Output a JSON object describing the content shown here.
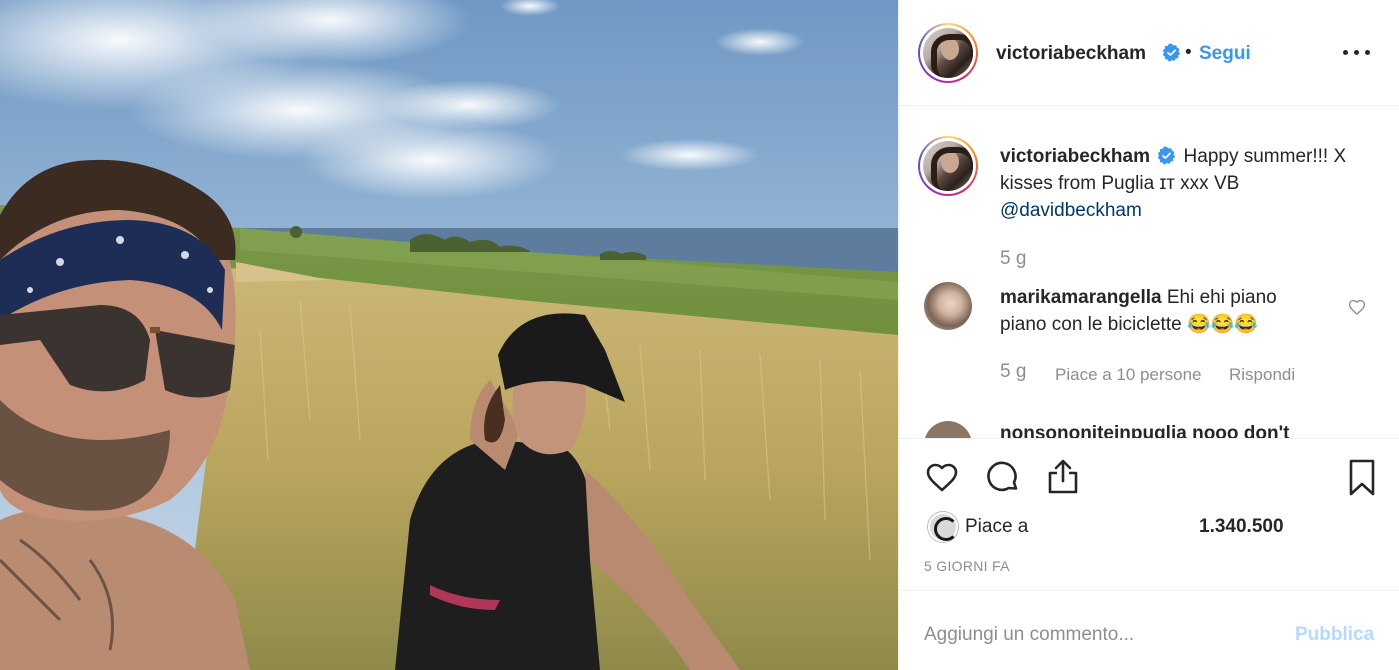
{
  "post": {
    "username": "victoriabeckham",
    "dot": "•",
    "follow_label": "Segui",
    "icons": {
      "verified": "verified-badge-icon",
      "more": "more-options-icon",
      "like": "heart-icon",
      "comment": "comment-bubble-icon",
      "share": "share-icon",
      "save": "bookmark-icon"
    },
    "accent_color": "#3897f0"
  },
  "caption": {
    "username": "victoriabeckham",
    "text_line1": "Happy summer!!! X",
    "text_line2": "kisses from Puglia ɪᴛ xxx VB",
    "mention": "@davidbeckham",
    "time": "5 g"
  },
  "comments": [
    {
      "username": "marikamarangella",
      "text_line1": "Ehi ehi piano",
      "text_line2": "piano con le biciclette 😂😂😂",
      "time": "5 g",
      "likes": "Piace a 10 persone",
      "reply_label": "Rispondi"
    },
    {
      "username_partial": "nonsononiteinpuglia nooo  don't"
    }
  ],
  "likes": {
    "prefix": "Piace a",
    "count": "1.340.500"
  },
  "timestamp": "5 GIORNI FA",
  "add_comment": {
    "placeholder": "Aggiungi un commento...",
    "publish_label": "Pubblica"
  }
}
